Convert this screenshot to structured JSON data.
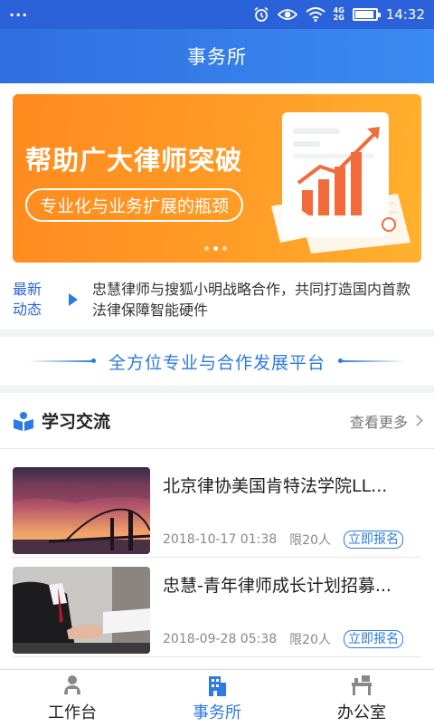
{
  "status_bar": {
    "menu_dots": "···",
    "net_top": "4G",
    "net_bottom": "2G",
    "time": "14:32",
    "battery_level": 0.85
  },
  "header": {
    "title": "事务所"
  },
  "banner": {
    "headline": "帮助广大律师突破",
    "subline": "专业化与业务扩展的瓶颈",
    "slide_count": 3,
    "active_slide": 1
  },
  "news": {
    "tag_line1": "最新",
    "tag_line2": "动态",
    "text": "忠慧律师与搜狐小明战略合作，共同打造国内首款法律保障智能硬件"
  },
  "platform": {
    "text": "全方位专业与合作发展平台"
  },
  "learning": {
    "title": "学习交流",
    "more_label": "查看更多",
    "items": [
      {
        "title": "北京律协美国肯特法学院LL...",
        "datetime": "2018-10-17 01:38",
        "limit": "限20人",
        "action": "立即报名"
      },
      {
        "title": "忠慧-青年律师成长计划招募...",
        "datetime": "2018-09-28 05:38",
        "limit": "限20人",
        "action": "立即报名"
      }
    ]
  },
  "tabs": [
    {
      "label": "工作台",
      "icon": "person-desk-icon",
      "active": false
    },
    {
      "label": "事务所",
      "icon": "building-icon",
      "active": true
    },
    {
      "label": "办公室",
      "icon": "office-desk-icon",
      "active": false
    }
  ],
  "colors": {
    "primary": "#2b62d9",
    "accent": "#2b7be0",
    "banner": "#ff9c26"
  }
}
